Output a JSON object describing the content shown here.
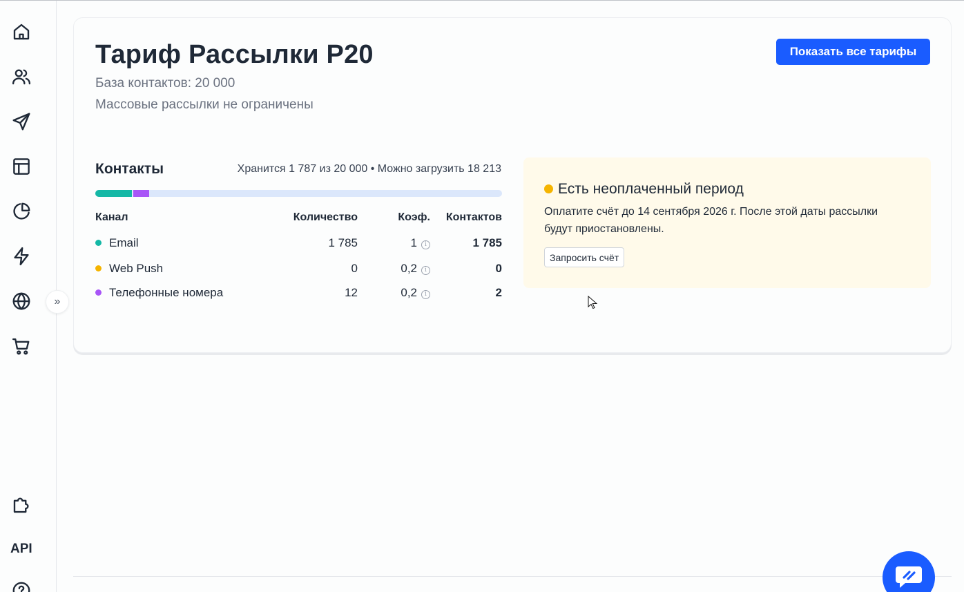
{
  "sidebar": {
    "items": [
      {
        "name": "home-icon"
      },
      {
        "name": "users-icon"
      },
      {
        "name": "send-icon"
      },
      {
        "name": "layout-icon"
      },
      {
        "name": "pie-chart-icon"
      },
      {
        "name": "lightning-icon"
      },
      {
        "name": "globe-icon"
      },
      {
        "name": "cart-icon"
      },
      {
        "name": "puzzle-icon"
      },
      {
        "name": "help-icon"
      }
    ],
    "api_label": "API",
    "expand_icon": "»"
  },
  "plan": {
    "title": "Тариф Рассылки Р20",
    "contacts_base": "База контактов: 20 000",
    "mailings": "Массовые рассылки не ограничены",
    "show_all_button": "Показать все тарифы"
  },
  "contacts": {
    "title": "Контакты",
    "info": "Хранится 1 787 из 20 000 • Можно загрузить 18 213",
    "usage": {
      "limit": 20000,
      "segments": [
        {
          "channel": "Email",
          "value": 1785,
          "color": "#14b8a6"
        },
        {
          "channel": "Телефонные номера",
          "value": 12,
          "color": "#a855f7"
        }
      ]
    },
    "table": {
      "headers": [
        "Канал",
        "Количество",
        "Коэф.",
        "Контактов"
      ],
      "rows": [
        {
          "channel": "Email",
          "color": "#14b8a6",
          "count": "1 785",
          "coef": "1",
          "contacts": "1 785"
        },
        {
          "channel": "Web Push",
          "color": "#f5b400",
          "count": "0",
          "coef": "0,2",
          "contacts": "0"
        },
        {
          "channel": "Телефонные номера",
          "color": "#a855f7",
          "count": "12",
          "coef": "0,2",
          "contacts": "2"
        }
      ]
    }
  },
  "notice": {
    "title": "Есть неоплаченный период",
    "text": "Оплатите счёт до 14 сентября 2026 г. После этой даты рассылки будут приостановлены.",
    "button": "Запросить счёт",
    "color": "#f5b400"
  },
  "colors": {
    "accent": "#1a5cff"
  }
}
